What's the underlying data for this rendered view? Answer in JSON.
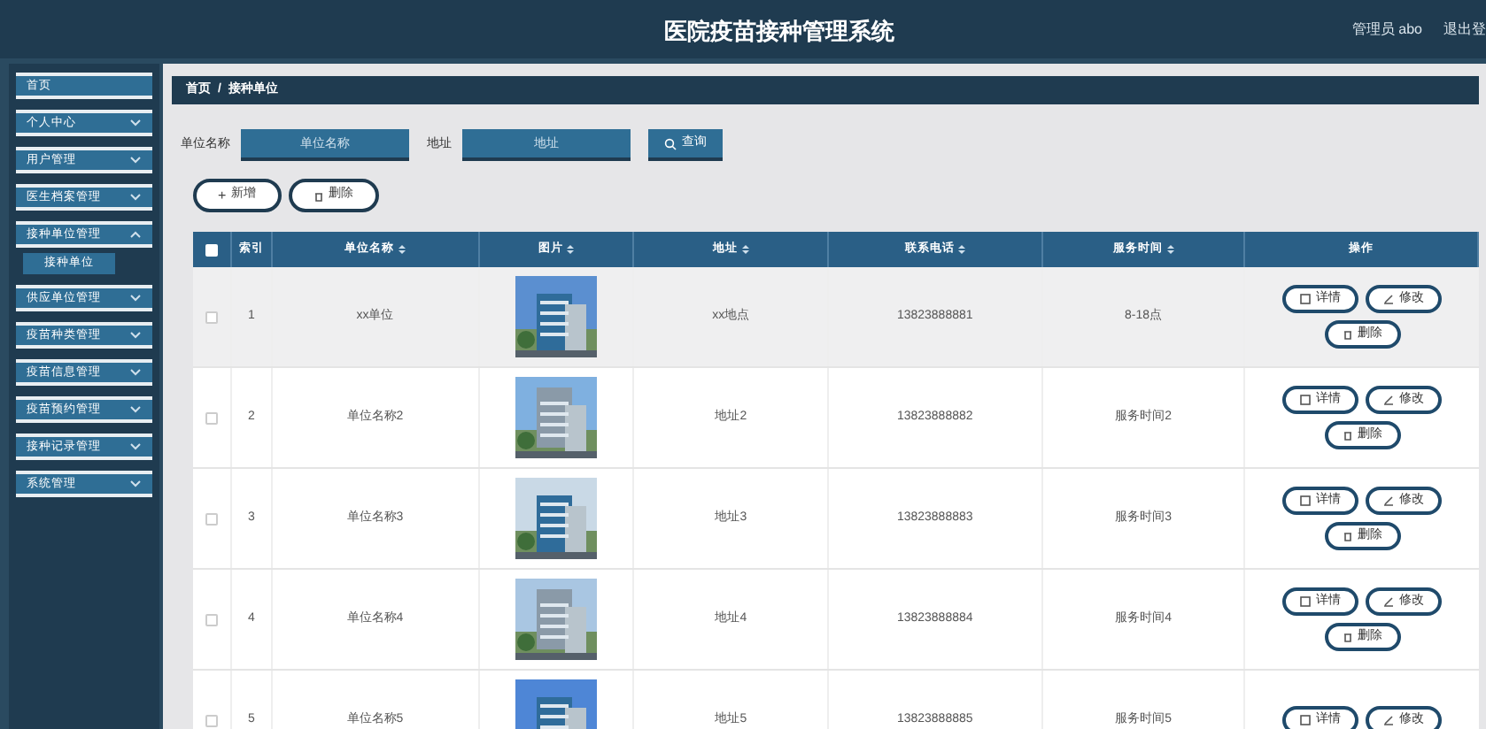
{
  "header": {
    "title": "医院疫苗接种管理系统",
    "user": "管理员 abo",
    "logout": "退出登"
  },
  "sidebar": {
    "items": [
      {
        "label": "首页",
        "kind": "link"
      },
      {
        "label": "个人中心",
        "kind": "menu",
        "expanded": false
      },
      {
        "label": "用户管理",
        "kind": "menu",
        "expanded": false
      },
      {
        "label": "医生档案管理",
        "kind": "menu",
        "expanded": false
      },
      {
        "label": "接种单位管理",
        "kind": "menu",
        "expanded": true,
        "children": [
          {
            "label": "接种单位",
            "selected": true
          }
        ]
      },
      {
        "label": "供应单位管理",
        "kind": "menu",
        "expanded": false
      },
      {
        "label": "疫苗种类管理",
        "kind": "menu",
        "expanded": false
      },
      {
        "label": "疫苗信息管理",
        "kind": "menu",
        "expanded": false
      },
      {
        "label": "疫苗预约管理",
        "kind": "menu",
        "expanded": false
      },
      {
        "label": "接种记录管理",
        "kind": "menu",
        "expanded": false
      },
      {
        "label": "系统管理",
        "kind": "menu",
        "expanded": false
      }
    ]
  },
  "breadcrumb": [
    "首页",
    "/",
    "接种单位"
  ],
  "search": {
    "fields": [
      {
        "label": "单位名称",
        "placeholder": "单位名称"
      },
      {
        "label": "地址",
        "placeholder": "地址"
      }
    ],
    "button": "查询"
  },
  "actions": {
    "add_icon": "+",
    "add": "新增",
    "delete": "删除"
  },
  "table": {
    "all_checked": false,
    "columns": [
      "索引",
      "单位名称",
      "图片",
      "地址",
      "联系电话",
      "服务时间",
      "操作"
    ],
    "rows": [
      {
        "index": "1",
        "name": "xx单位",
        "address": "xx地点",
        "phone": "13823888881",
        "hours": "8-18点",
        "checked": false,
        "hovered": true,
        "buttons": {
          "detail": "详情",
          "edit": "修改",
          "delete": "删除"
        }
      },
      {
        "index": "2",
        "name": "单位名称2",
        "address": "地址2",
        "phone": "13823888882",
        "hours": "服务时间2",
        "checked": false,
        "hovered": false,
        "buttons": {
          "detail": "详情",
          "edit": "修改",
          "delete": "删除"
        }
      },
      {
        "index": "3",
        "name": "单位名称3",
        "address": "地址3",
        "phone": "13823888883",
        "hours": "服务时间3",
        "checked": false,
        "hovered": false,
        "buttons": {
          "detail": "详情",
          "edit": "修改",
          "delete": "删除"
        }
      },
      {
        "index": "4",
        "name": "单位名称4",
        "address": "地址4",
        "phone": "13823888884",
        "hours": "服务时间4",
        "checked": false,
        "hovered": false,
        "buttons": {
          "detail": "详情",
          "edit": "修改",
          "delete": "删除"
        }
      },
      {
        "index": "5",
        "name": "单位名称5",
        "address": "地址5",
        "phone": "13823888885",
        "hours": "服务时间5",
        "checked": false,
        "hovered": false,
        "buttons": {
          "detail": "详情",
          "edit": "修改"
        }
      }
    ]
  }
}
